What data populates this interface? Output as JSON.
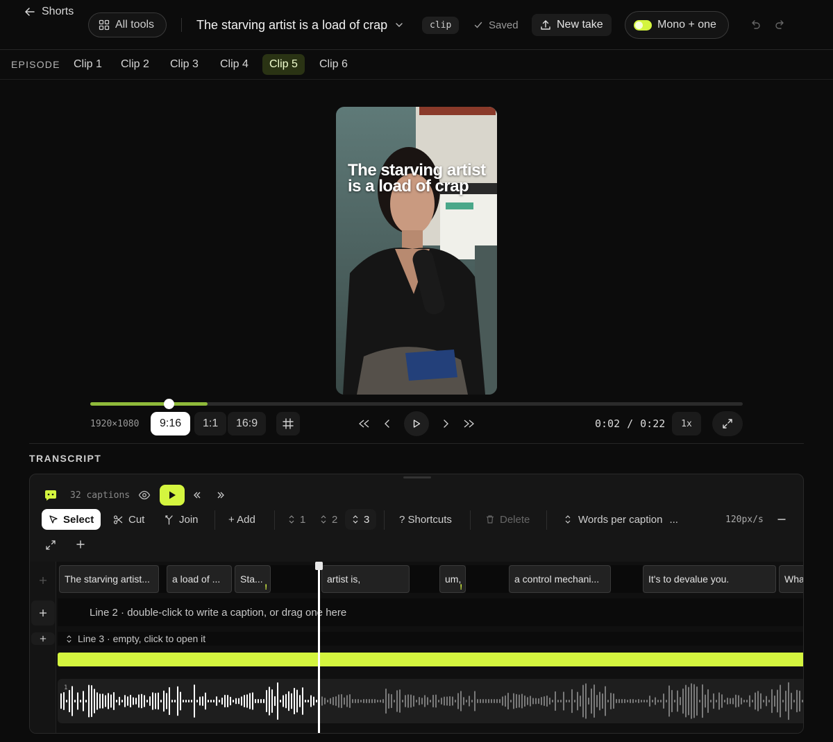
{
  "topbar": {
    "back_label": "Shorts",
    "all_tools_label": "All tools",
    "project_title": "The starving artist is a load of crap",
    "clip_badge": "clip",
    "saved_label": "Saved",
    "new_take_label": "New take",
    "mode_toggle_label": "Mono + one"
  },
  "tabs": {
    "episode_label": "EPISODE",
    "items": [
      "Clip 1",
      "Clip 2",
      "Clip 3",
      "Clip 4",
      "Clip 5",
      "Clip 6"
    ],
    "active_index": 4
  },
  "video": {
    "caption_overlay": "The starving artist is a load of crap"
  },
  "player": {
    "resolution": "1920×1080",
    "aspect_options": [
      "9:16",
      "1:1",
      "16:9"
    ],
    "aspect_selected": "9:16",
    "progress_fraction": 0.12,
    "current_time": "0:02",
    "separator": "/",
    "duration": "0:22",
    "speed": "1x"
  },
  "transcript": {
    "section_title": "TRANSCRIPT",
    "caption_count": "32 captions",
    "tools": {
      "select": "Select",
      "cut": "Cut",
      "join": "Join",
      "add": "+ Add",
      "line1": "1",
      "line2": "2",
      "line3": "3",
      "shortcuts": "? Shortcuts",
      "delete": "Delete",
      "words_per_caption": "Words per caption",
      "words_per_caption_value": "...",
      "zoom": "120px/s"
    },
    "captions": [
      "The starving artist...",
      "a load of ...",
      "Sta...",
      "artist is,",
      "um,",
      "a control mechani...",
      "It's to devalue you.",
      "Wha"
    ],
    "warn_mark": "!",
    "line2_hint": "Line 2 · double-click to write a caption, or drag one here",
    "line3_hint": "Line 3 · empty, click to open it",
    "waveform_track_number": "1"
  },
  "colors": {
    "accent": "#d4f53f",
    "background": "#0c0c0c"
  }
}
